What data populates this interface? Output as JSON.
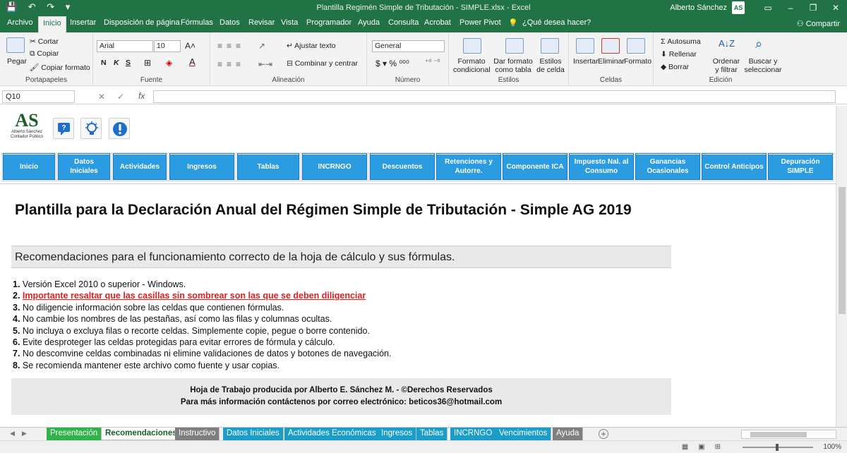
{
  "window": {
    "title": "Plantilla Regimén Simple de Tributación - SIMPLE.xlsx  -  Excel",
    "user": "Alberto Sánchez",
    "avatar_text": "AS",
    "quick_access": "💾 ↶ ↷ ▾"
  },
  "menu_tabs": [
    "Archivo",
    "Inicio",
    "Insertar",
    "Disposición de página",
    "Fórmulas",
    "Datos",
    "Revisar",
    "Vista",
    "Programador",
    "Ayuda",
    "Consulta",
    "Acrobat",
    "Power Pivot",
    "¿Qué desea hacer?"
  ],
  "share": "Compartir",
  "ribbon": {
    "portapapeles": {
      "pegar": "Pegar",
      "cortar": "Cortar",
      "copiar": "Copiar",
      "copiar_formato": "Copiar formato",
      "label": "Portapapeles"
    },
    "fuente": {
      "font": "Arial",
      "size": "10",
      "bold": "N",
      "italic": "K",
      "underline": "S",
      "label": "Fuente"
    },
    "alineacion": {
      "ajustar": "Ajustar texto",
      "combinar": "Combinar y centrar",
      "label": "Alineación"
    },
    "numero": {
      "format": "General",
      "label": "Número"
    },
    "estilos": {
      "condicional": "Formato condicional",
      "tabla": "Dar formato como tabla",
      "celda": "Estilos de celda",
      "label": "Estilos"
    },
    "celdas": {
      "insertar": "Insertar",
      "eliminar": "Eliminar",
      "formato": "Formato",
      "label": "Celdas"
    },
    "edicion": {
      "autosuma": "Autosuma",
      "rellenar": "Rellenar",
      "borrar": "Borrar",
      "ordenar": "Ordenar y filtrar",
      "buscar": "Buscar y seleccionar",
      "label": "Edición"
    }
  },
  "formula_bar": {
    "cell": "Q10",
    "fx": "fx",
    "value": ""
  },
  "logo": {
    "mark": "AS",
    "line1": "Alberto Sánchez",
    "line2": "Contador Público"
  },
  "nav_buttons": [
    "Inicio",
    "Datos Iniciales",
    "Actividades",
    "Ingresos",
    "Tablas",
    "INCRNGO",
    "Descuentos",
    "Retenciones y Autorre.",
    "Componente ICA",
    "Impuesto Nal. al Consumo",
    "Ganancias Ocasionales",
    "Control Anticipos",
    "Depuración SIMPLE"
  ],
  "page_title": "Plantilla para la Declaración Anual del Régimen Simple de Tributación - Simple AG 2019",
  "recommendations_header": "Recomendaciones para el funcionamiento correcto de la hoja de cálculo y sus fórmulas.",
  "recommendations": [
    {
      "n": "1.",
      "t": "Versión Excel 2010 o superior - Windows."
    },
    {
      "n": "2.",
      "t": "Importante resaltar que las casillas sin sombrear son las que se deben diligenciar"
    },
    {
      "n": "3.",
      "t": "No diligencie información sobre las celdas que contienen fórmulas."
    },
    {
      "n": "4.",
      "t": "No cambie los nombres de las pestañas, así como las filas y columnas ocultas."
    },
    {
      "n": "5.",
      "t": "No incluya o excluya filas o recorte celdas. Simplemente copie, pegue o borre contenido."
    },
    {
      "n": "6.",
      "t": "Evite desproteger las celdas protegidas para evitar errores de fórmula y cálculo."
    },
    {
      "n": "7.",
      "t": "No descomvine celdas combinadas ni elimine validaciones de datos y botones de navegación."
    },
    {
      "n": "8.",
      "t": "Se recomienda mantener este archivo como fuente y usar copias."
    }
  ],
  "footer": {
    "line1": "Hoja de Trabajo producida por Alberto E. Sánchez M. - ©Derechos Reservados",
    "line2": "Para más información contáctenos por correo electrónico: beticos36@hotmail.com"
  },
  "sheet_tabs": [
    {
      "name": "Presentación",
      "color": "#2fb34a"
    },
    {
      "name": "Recomendaciones",
      "color": "#ffffff"
    },
    {
      "name": "Instructivo",
      "color": "#7f7f7f"
    },
    {
      "name": "Datos Iniciales",
      "color": "#1a9ec9"
    },
    {
      "name": "Actividades Económicas",
      "color": "#1a9ec9"
    },
    {
      "name": "Ingresos",
      "color": "#1a9ec9"
    },
    {
      "name": "Tablas",
      "color": "#1a9ec9"
    },
    {
      "name": "INCRNGO",
      "color": "#1a9ec9"
    },
    {
      "name": "Vencimientos",
      "color": "#1a9ec9"
    },
    {
      "name": "Ayuda",
      "color": "#7f7f7f"
    }
  ],
  "zoom": "100%",
  "colors": {
    "excel_green": "#217346",
    "nav_blue": "#2b9be2",
    "warning_red": "#e01f1f"
  }
}
